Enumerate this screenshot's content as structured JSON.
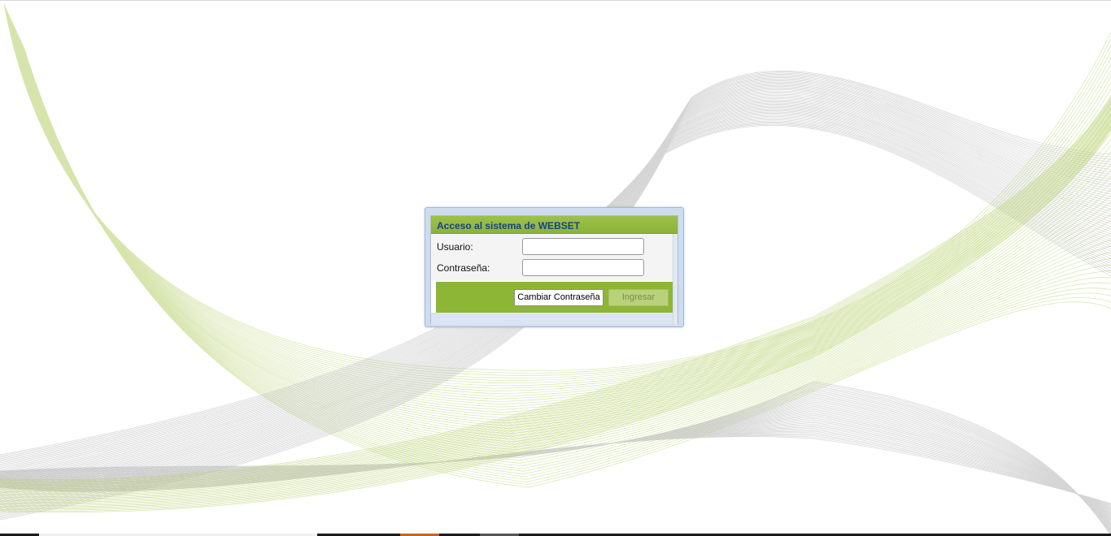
{
  "login": {
    "title": "Acceso al sistema de WEBSET",
    "username_label": "Usuario:",
    "username_value": "",
    "password_label": "Contraseña:",
    "password_value": "",
    "change_password_button": "Cambiar Contraseña",
    "login_button": "Ingresar",
    "login_button_enabled": false
  },
  "colors": {
    "header_green": "#8db536",
    "title_text": "#15428b",
    "window_frame": "#cfdcec",
    "wave_gray": "#b4b4b4",
    "wave_green": "#b5d06b"
  }
}
